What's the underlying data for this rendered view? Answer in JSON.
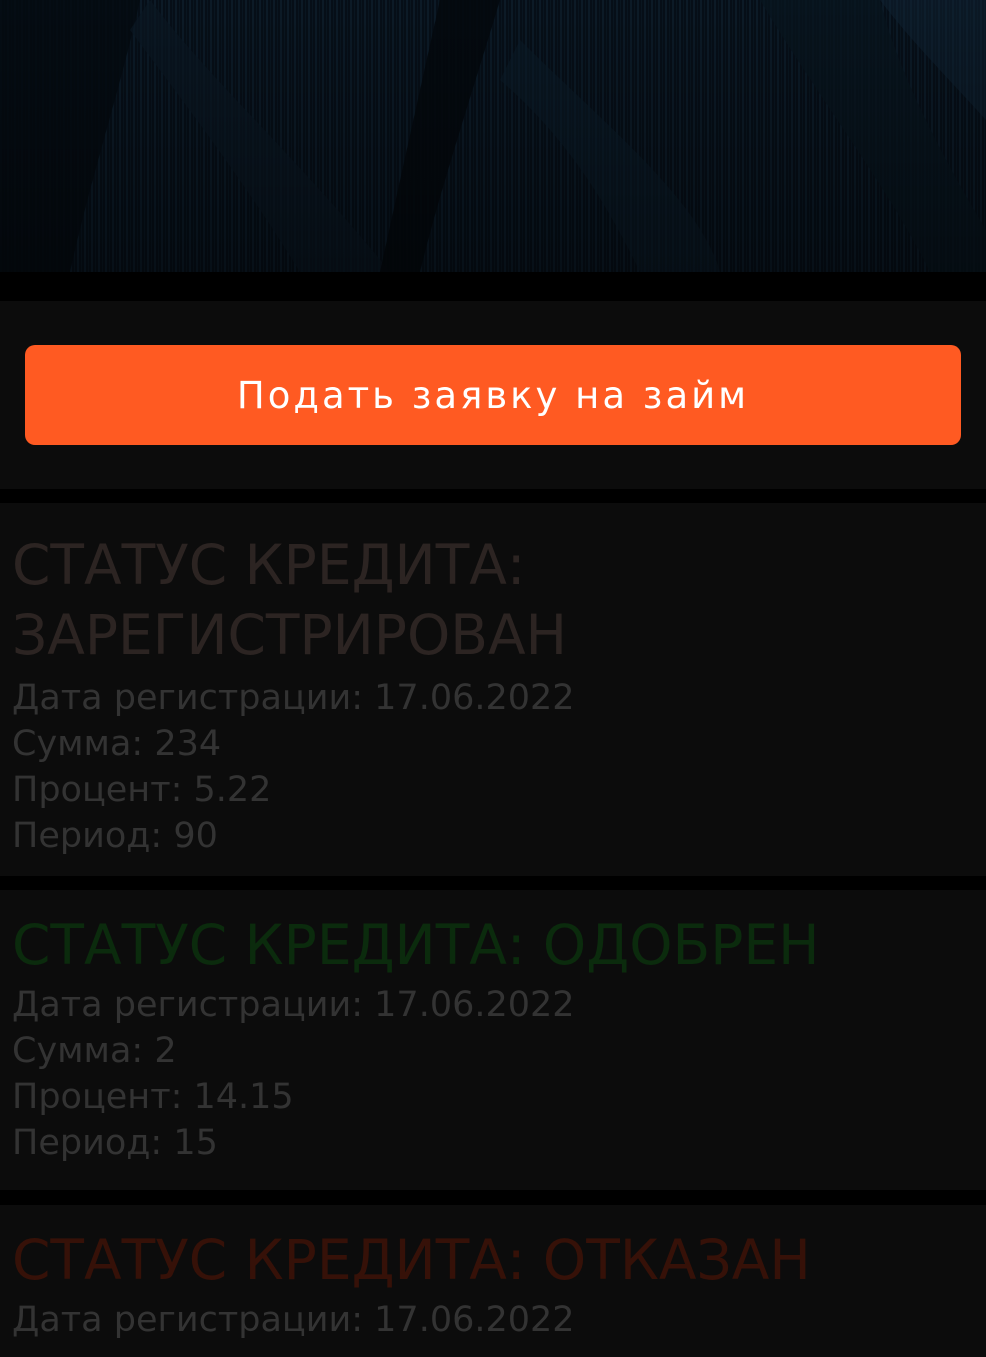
{
  "colors": {
    "accent": "#ff5a22",
    "background": "#000000",
    "card_background": "#0c0c0c",
    "status_registered": "#2c2422",
    "status_approved": "#0b2b0d",
    "status_rejected": "#361108",
    "field_text": "#333333"
  },
  "apply_button": {
    "label": "Подать заявку на займ"
  },
  "loans": [
    {
      "status": "СТАТУС КРЕДИТА:\nЗАРЕГИСТРИРОВАН",
      "registration_date": "Дата регистрации: 17.06.2022",
      "amount": "Сумма: 234",
      "percent": "Процент: 5.22",
      "period": "Период: 90"
    },
    {
      "status": "СТАТУС КРЕДИТА: ОДОБРЕН",
      "registration_date": "Дата регистрации: 17.06.2022",
      "amount": "Сумма: 2",
      "percent": "Процент: 14.15",
      "period": "Период: 15"
    },
    {
      "status": "СТАТУС КРЕДИТА: ОТКАЗАН",
      "registration_date": "Дата регистрации: 17.06.2022"
    }
  ]
}
